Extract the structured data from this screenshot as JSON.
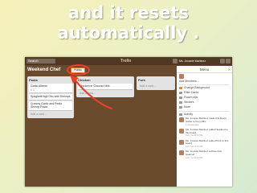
{
  "slide": {
    "caption_line1": "and it resets",
    "caption_line2": "automatically ."
  },
  "app": {
    "search_label": "Search",
    "logo": "Trello",
    "user_name": "Ms. Jovanie Martinez",
    "board_title": "Weekend Chef",
    "privacy_label": "Public"
  },
  "lists": [
    {
      "title": "Pasta",
      "cards": [
        {
          "title": "Garlic Alfredo",
          "sub": "≡ 1"
        },
        {
          "title": "Spaghetti Agli Olio with Shrimps",
          "sub": ""
        },
        {
          "title": "Creamy Garlic and Pesto Shrimp Pasta",
          "sub": ""
        }
      ],
      "add_label": "Add a card..."
    },
    {
      "title": "Chicken",
      "cards": [
        {
          "title": "Chicken in Coconut Milk",
          "sub": ""
        }
      ],
      "add_label": "Add a card..."
    },
    {
      "title": "Pork",
      "cards": [],
      "add_label": "Add a card..."
    }
  ],
  "menu": {
    "title": "Menu",
    "close": "✕",
    "members_action": "Add Members...",
    "items": [
      {
        "label": "Change Background",
        "icon": "square-orange-icon"
      },
      {
        "label": "Filter Cards",
        "icon": "filter-icon"
      },
      {
        "label": "Power-Ups",
        "icon": "power-ups-icon"
      },
      {
        "label": "Stickers",
        "icon": "sticker-icon"
      },
      {
        "label": "More",
        "icon": "more-icon"
      }
    ],
    "activity_title": "Activity",
    "activity": [
      {
        "text": "Ms. Jovanie Martinez made this board visible to the public",
        "time": "5 minutes ago"
      },
      {
        "text": "Ms. Jovanie Martinez added Seafood to this board",
        "time": "Feb 7 at 12:13 PM"
      },
      {
        "text": "Ms. Jovanie Martinez added Pork to this board",
        "time": "Feb 7 at 12:13 PM"
      },
      {
        "text": "Ms. Jovanie Martinez archived list Seafood",
        "time": "Feb 7 at 12:13 PM"
      }
    ]
  },
  "colors": {
    "annotation": "#e8412c",
    "board_bg": "#6a4a2d",
    "caption": "#ffffff"
  }
}
